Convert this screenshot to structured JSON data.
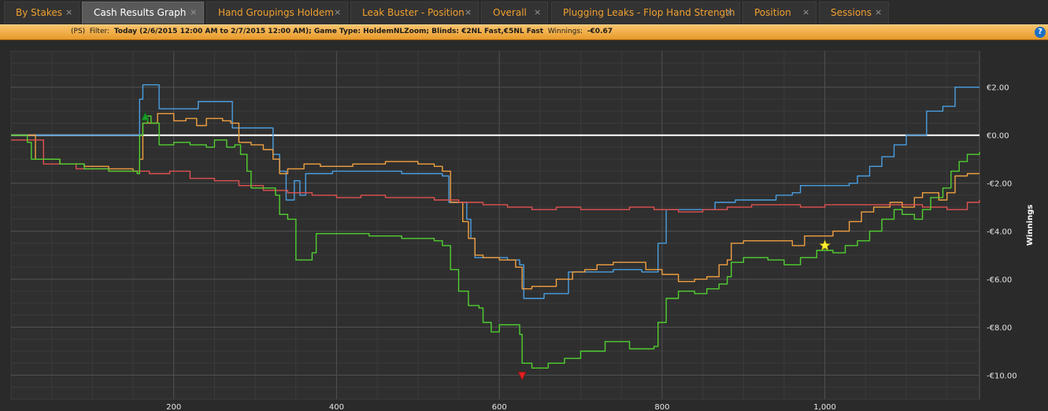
{
  "tabs": [
    {
      "label": "By Stakes",
      "active": false
    },
    {
      "label": "Cash Results Graph",
      "active": true
    },
    {
      "label": "Hand Groupings Holdem",
      "active": false
    },
    {
      "label": "Leak Buster - Position",
      "active": false
    },
    {
      "label": "Overall",
      "active": false
    },
    {
      "label": "Plugging Leaks - Flop Hand Strength",
      "active": false
    },
    {
      "label": "Position",
      "active": false
    },
    {
      "label": "Sessions",
      "active": false
    }
  ],
  "tab_close_glyph": "×",
  "filter": {
    "site": "(PS)",
    "filter_label": "Filter:",
    "filter_value": "Today (2/6/2015 12:00 AM to 2/7/2015 12:00 AM); Game Type: HoldemNLZoom; Blinds: €2NL Fast,€5NL Fast",
    "winnings_label": "Winnings:",
    "winnings_value": "-€0.67"
  },
  "help_glyph": "?",
  "icons": {
    "help": "help-icon",
    "high_marker": "up-triangle-icon",
    "low_marker": "down-triangle-icon",
    "star_marker": "star-icon"
  },
  "colors": {
    "background": "#2a2a2a",
    "plot_bg": "#2f2f2f",
    "grid": "#505050",
    "zero_line": "#ffffff",
    "tab_text": "#f0a030",
    "filter_bar": "#f0ac48"
  },
  "chart_data": {
    "type": "line",
    "xlabel": "",
    "ylabel": "Winnings",
    "xlim": [
      0,
      1190
    ],
    "ylim": [
      -11,
      3.5
    ],
    "x_ticks": [
      200,
      400,
      600,
      800,
      1000
    ],
    "x_tick_labels": [
      "200",
      "400",
      "600",
      "800",
      "1,000"
    ],
    "y_ticks": [
      2,
      0,
      -2,
      -4,
      -6,
      -8,
      -10
    ],
    "y_tick_labels": [
      "€2.00",
      "€0.00",
      "-€2.00",
      "-€4.00",
      "-€6.00",
      "-€8.00",
      "-€10.00"
    ],
    "zero_line": 0,
    "series": [
      {
        "color": "#4a9fe0",
        "points": [
          [
            0,
            0
          ],
          [
            155,
            0
          ],
          [
            158,
            1.5
          ],
          [
            162,
            2.1
          ],
          [
            178,
            2.1
          ],
          [
            182,
            1.1
          ],
          [
            228,
            1.1
          ],
          [
            230,
            1.4
          ],
          [
            268,
            1.4
          ],
          [
            272,
            0.3
          ],
          [
            318,
            0.3
          ],
          [
            322,
            -0.8
          ],
          [
            330,
            -1.5
          ],
          [
            338,
            -2.7
          ],
          [
            345,
            -2.7
          ],
          [
            348,
            -1.9
          ],
          [
            355,
            -2.5
          ],
          [
            362,
            -1.6
          ],
          [
            395,
            -1.5
          ],
          [
            430,
            -1.5
          ],
          [
            480,
            -1.6
          ],
          [
            520,
            -1.6
          ],
          [
            530,
            -1.7
          ],
          [
            538,
            -2.8
          ],
          [
            560,
            -3.5
          ],
          [
            565,
            -4.3
          ],
          [
            570,
            -5.1
          ],
          [
            600,
            -5.1
          ],
          [
            610,
            -5.2
          ],
          [
            625,
            -5.4
          ],
          [
            630,
            -6.8
          ],
          [
            650,
            -6.8
          ],
          [
            655,
            -6.6
          ],
          [
            680,
            -6.6
          ],
          [
            685,
            -5.7
          ],
          [
            720,
            -5.7
          ],
          [
            740,
            -5.6
          ],
          [
            760,
            -5.6
          ],
          [
            775,
            -5.7
          ],
          [
            790,
            -5.7
          ],
          [
            795,
            -4.5
          ],
          [
            805,
            -3.1
          ],
          [
            860,
            -3.1
          ],
          [
            865,
            -2.8
          ],
          [
            885,
            -2.8
          ],
          [
            890,
            -2.7
          ],
          [
            940,
            -2.5
          ],
          [
            960,
            -2.4
          ],
          [
            970,
            -2.1
          ],
          [
            980,
            -2.1
          ],
          [
            990,
            -2.1
          ],
          [
            1020,
            -2.1
          ],
          [
            1030,
            -2.0
          ],
          [
            1040,
            -1.7
          ],
          [
            1055,
            -1.3
          ],
          [
            1070,
            -0.9
          ],
          [
            1085,
            -0.4
          ],
          [
            1100,
            0
          ],
          [
            1120,
            0
          ],
          [
            1125,
            1.0
          ],
          [
            1145,
            1.2
          ],
          [
            1160,
            2.0
          ],
          [
            1190,
            2.0
          ]
        ]
      },
      {
        "color": "#f0a040",
        "points": [
          [
            0,
            0
          ],
          [
            30,
            -1.0
          ],
          [
            60,
            -1.2
          ],
          [
            90,
            -1.3
          ],
          [
            120,
            -1.4
          ],
          [
            150,
            -1.5
          ],
          [
            158,
            -1.0
          ],
          [
            162,
            0.5
          ],
          [
            172,
            0.5
          ],
          [
            180,
            0.9
          ],
          [
            190,
            0.9
          ],
          [
            200,
            0.6
          ],
          [
            215,
            0.7
          ],
          [
            228,
            0.4
          ],
          [
            240,
            0.7
          ],
          [
            260,
            0.6
          ],
          [
            270,
            0.5
          ],
          [
            280,
            -0.3
          ],
          [
            295,
            -0.4
          ],
          [
            310,
            -0.6
          ],
          [
            322,
            -1.0
          ],
          [
            330,
            -1.6
          ],
          [
            340,
            -1.4
          ],
          [
            360,
            -1.2
          ],
          [
            380,
            -1.3
          ],
          [
            420,
            -1.2
          ],
          [
            460,
            -1.1
          ],
          [
            500,
            -1.2
          ],
          [
            520,
            -1.3
          ],
          [
            530,
            -1.5
          ],
          [
            540,
            -2.8
          ],
          [
            555,
            -3.6
          ],
          [
            562,
            -4.3
          ],
          [
            570,
            -5.0
          ],
          [
            580,
            -5.1
          ],
          [
            600,
            -5.2
          ],
          [
            620,
            -5.5
          ],
          [
            628,
            -6.4
          ],
          [
            640,
            -6.3
          ],
          [
            660,
            -6.3
          ],
          [
            670,
            -6.0
          ],
          [
            690,
            -5.7
          ],
          [
            705,
            -5.6
          ],
          [
            720,
            -5.4
          ],
          [
            740,
            -5.3
          ],
          [
            760,
            -5.3
          ],
          [
            780,
            -5.6
          ],
          [
            800,
            -5.8
          ],
          [
            820,
            -6.1
          ],
          [
            840,
            -6.0
          ],
          [
            855,
            -5.9
          ],
          [
            870,
            -5.4
          ],
          [
            880,
            -5.2
          ],
          [
            885,
            -4.5
          ],
          [
            900,
            -4.4
          ],
          [
            930,
            -4.4
          ],
          [
            960,
            -4.6
          ],
          [
            975,
            -4.2
          ],
          [
            990,
            -4.2
          ],
          [
            1010,
            -4.0
          ],
          [
            1030,
            -3.6
          ],
          [
            1045,
            -3.2
          ],
          [
            1060,
            -3.0
          ],
          [
            1080,
            -2.8
          ],
          [
            1095,
            -3.0
          ],
          [
            1110,
            -2.6
          ],
          [
            1120,
            -2.4
          ],
          [
            1140,
            -2.7
          ],
          [
            1150,
            -2.4
          ],
          [
            1160,
            -1.7
          ],
          [
            1175,
            -1.6
          ],
          [
            1190,
            -1.6
          ]
        ]
      },
      {
        "color": "#e05050",
        "points": [
          [
            0,
            -0.2
          ],
          [
            40,
            -1.2
          ],
          [
            80,
            -1.4
          ],
          [
            120,
            -1.5
          ],
          [
            150,
            -1.5
          ],
          [
            170,
            -1.6
          ],
          [
            195,
            -1.5
          ],
          [
            220,
            -1.8
          ],
          [
            250,
            -1.9
          ],
          [
            280,
            -2.1
          ],
          [
            310,
            -2.3
          ],
          [
            340,
            -2.4
          ],
          [
            370,
            -2.5
          ],
          [
            400,
            -2.6
          ],
          [
            430,
            -2.5
          ],
          [
            460,
            -2.6
          ],
          [
            490,
            -2.6
          ],
          [
            520,
            -2.7
          ],
          [
            550,
            -2.8
          ],
          [
            580,
            -2.9
          ],
          [
            610,
            -3.0
          ],
          [
            640,
            -3.1
          ],
          [
            670,
            -3.0
          ],
          [
            700,
            -3.1
          ],
          [
            730,
            -3.1
          ],
          [
            760,
            -3.0
          ],
          [
            790,
            -3.1
          ],
          [
            820,
            -3.2
          ],
          [
            850,
            -3.1
          ],
          [
            880,
            -3.0
          ],
          [
            910,
            -2.9
          ],
          [
            940,
            -2.9
          ],
          [
            970,
            -3.0
          ],
          [
            1000,
            -2.9
          ],
          [
            1030,
            -2.9
          ],
          [
            1060,
            -2.9
          ],
          [
            1090,
            -2.9
          ],
          [
            1120,
            -3.0
          ],
          [
            1150,
            -3.1
          ],
          [
            1175,
            -2.8
          ],
          [
            1190,
            -2.7
          ]
        ]
      },
      {
        "color": "#50d030",
        "points": [
          [
            0,
            0
          ],
          [
            20,
            -0.3
          ],
          [
            25,
            -1.0
          ],
          [
            60,
            -1.2
          ],
          [
            90,
            -1.4
          ],
          [
            120,
            -1.5
          ],
          [
            150,
            -1.5
          ],
          [
            155,
            -1.6
          ],
          [
            158,
            0.0
          ],
          [
            162,
            0.5
          ],
          [
            168,
            0.8
          ],
          [
            172,
            0.5
          ],
          [
            178,
            0.5
          ],
          [
            182,
            -0.4
          ],
          [
            200,
            -0.3
          ],
          [
            220,
            -0.4
          ],
          [
            240,
            -0.5
          ],
          [
            250,
            -0.2
          ],
          [
            265,
            -0.5
          ],
          [
            275,
            -0.4
          ],
          [
            282,
            -0.8
          ],
          [
            290,
            -1.5
          ],
          [
            295,
            -2.2
          ],
          [
            325,
            -2.5
          ],
          [
            330,
            -3.3
          ],
          [
            340,
            -3.5
          ],
          [
            350,
            -5.2
          ],
          [
            370,
            -4.9
          ],
          [
            375,
            -4.1
          ],
          [
            400,
            -4.1
          ],
          [
            440,
            -4.2
          ],
          [
            480,
            -4.3
          ],
          [
            520,
            -4.4
          ],
          [
            530,
            -4.6
          ],
          [
            540,
            -5.6
          ],
          [
            550,
            -6.5
          ],
          [
            562,
            -7.1
          ],
          [
            575,
            -7.2
          ],
          [
            580,
            -7.8
          ],
          [
            590,
            -8.2
          ],
          [
            600,
            -7.9
          ],
          [
            620,
            -7.9
          ],
          [
            625,
            -8.3
          ],
          [
            628,
            -9.5
          ],
          [
            640,
            -9.7
          ],
          [
            660,
            -9.5
          ],
          [
            680,
            -9.3
          ],
          [
            700,
            -9.0
          ],
          [
            730,
            -8.6
          ],
          [
            760,
            -8.9
          ],
          [
            780,
            -8.9
          ],
          [
            790,
            -8.8
          ],
          [
            795,
            -7.8
          ],
          [
            805,
            -6.8
          ],
          [
            820,
            -6.5
          ],
          [
            840,
            -6.6
          ],
          [
            855,
            -6.4
          ],
          [
            870,
            -6.2
          ],
          [
            880,
            -5.9
          ],
          [
            885,
            -5.3
          ],
          [
            900,
            -5.1
          ],
          [
            930,
            -5.2
          ],
          [
            950,
            -5.4
          ],
          [
            970,
            -5.1
          ],
          [
            990,
            -4.8
          ],
          [
            1000,
            -4.8
          ],
          [
            1010,
            -4.9
          ],
          [
            1025,
            -4.6
          ],
          [
            1040,
            -4.4
          ],
          [
            1055,
            -4.0
          ],
          [
            1070,
            -3.5
          ],
          [
            1085,
            -3.1
          ],
          [
            1095,
            -3.3
          ],
          [
            1110,
            -3.5
          ],
          [
            1120,
            -3.1
          ],
          [
            1130,
            -2.6
          ],
          [
            1145,
            -2.2
          ],
          [
            1155,
            -1.5
          ],
          [
            1165,
            -1.1
          ],
          [
            1175,
            -0.8
          ],
          [
            1190,
            -0.7
          ]
        ]
      }
    ],
    "markers": [
      {
        "type": "high",
        "x": 165,
        "y": 0.75,
        "color": "#1a9a2a"
      },
      {
        "type": "low",
        "x": 628,
        "y": -10.0,
        "color": "#e02020"
      },
      {
        "type": "star",
        "x": 1000,
        "y": -4.6,
        "color": "#ffee30"
      }
    ]
  }
}
